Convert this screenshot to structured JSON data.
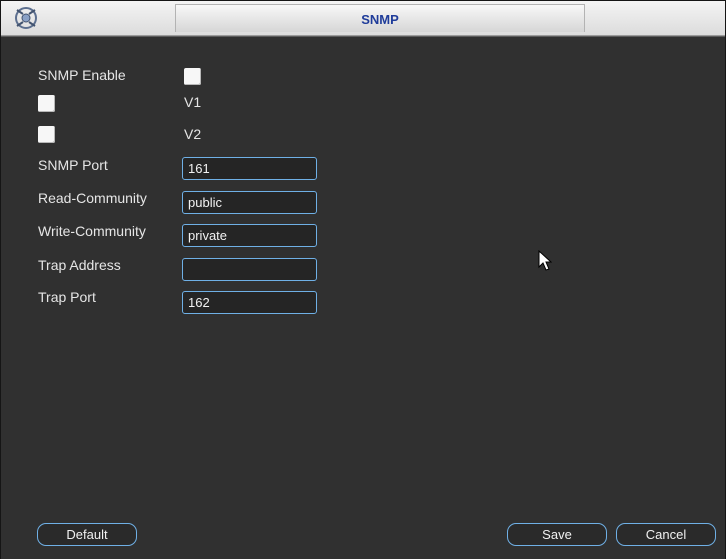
{
  "window": {
    "title": "SNMP"
  },
  "form": {
    "snmp_enable_label": "SNMP Enable",
    "v1_label": "V1",
    "v2_label": "V2",
    "snmp_port_label": "SNMP Port",
    "snmp_port_value": "161",
    "read_community_label": "Read-Community",
    "read_community_value": "public",
    "write_community_label": "Write-Community",
    "write_community_value": "private",
    "trap_address_label": "Trap Address",
    "trap_address_value": "",
    "trap_port_label": "Trap Port",
    "trap_port_value": "162"
  },
  "buttons": {
    "default_label": "Default",
    "save_label": "Save",
    "cancel_label": "Cancel"
  },
  "icons": {
    "logo": "app-logo-icon",
    "pointer": "mouse-cursor-icon"
  },
  "colors": {
    "title_text": "#1f3c9a",
    "field_border": "#6fb0e6",
    "background": "#303030"
  }
}
